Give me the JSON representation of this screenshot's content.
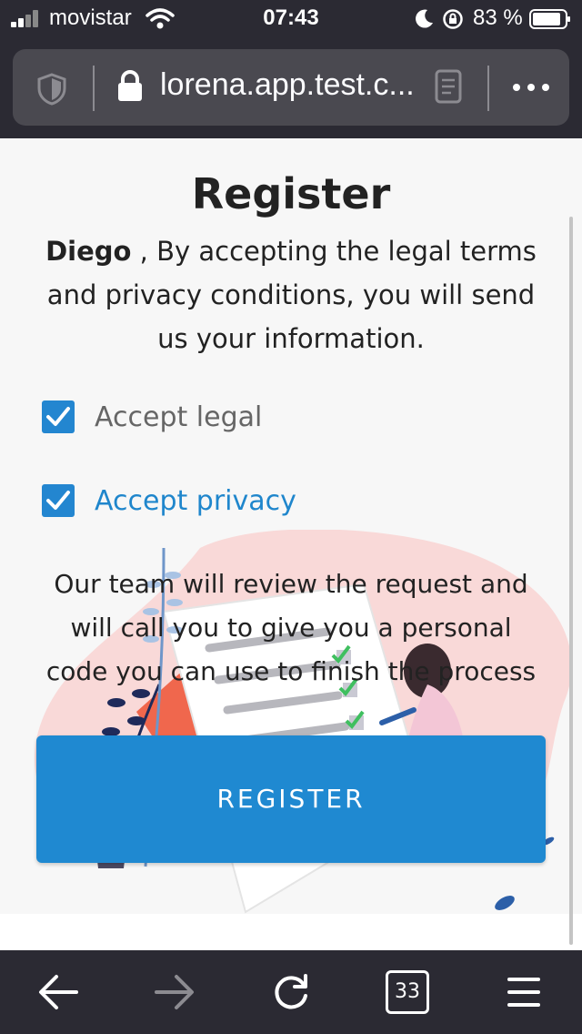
{
  "status_bar": {
    "carrier": "movistar",
    "time": "07:43",
    "battery_percent": "83 %"
  },
  "browser": {
    "url": "lorena.app.test.c...",
    "tab_count": "33"
  },
  "page": {
    "title": "Register",
    "intro_name": "Diego",
    "intro_text": " , By accepting the legal terms and privacy conditions, you will send us your information.",
    "accept_legal_label": "Accept legal",
    "accept_legal_checked": true,
    "accept_privacy_label": "Accept privacy",
    "accept_privacy_checked": true,
    "review_text": "Our team will review the request and will call you to give you a personal code you can use to finish the process",
    "register_button": "REGISTER"
  },
  "colors": {
    "accent": "#1f89d1",
    "chrome": "#2b2a33",
    "privacy_label": "#1f86cc"
  }
}
